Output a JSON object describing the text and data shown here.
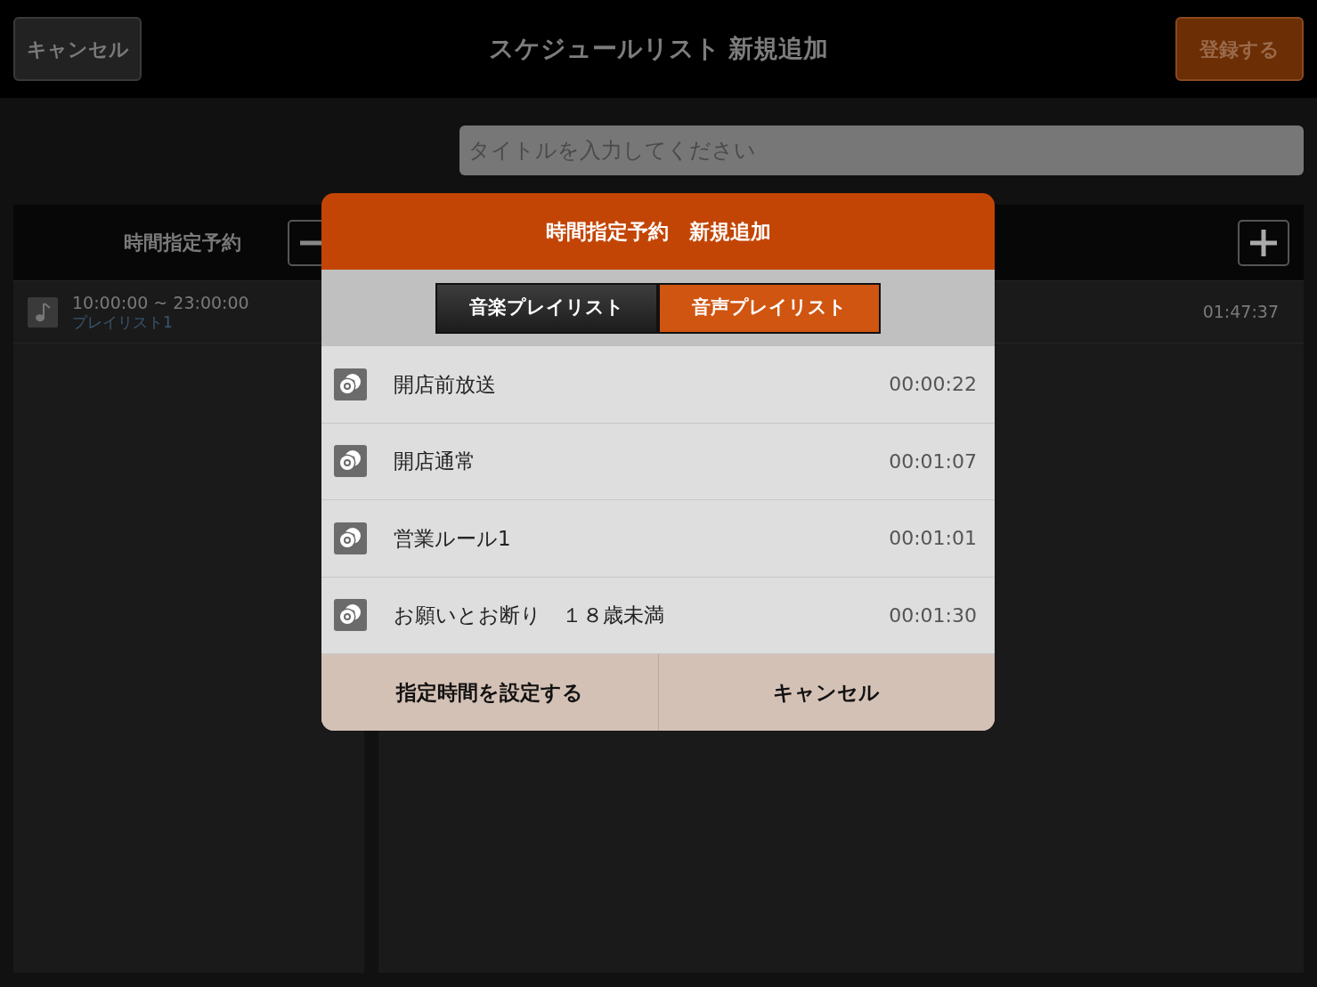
{
  "header": {
    "cancel_button": "キャンセル",
    "title": "スケジュールリスト 新規追加",
    "register_button": "登録する"
  },
  "title_field": {
    "placeholder": "タイトルを入力してください"
  },
  "left_panel": {
    "title": "時間指定予約",
    "items": [
      {
        "time_range": "10:00:00 ~ 23:00:00",
        "playlist": "プレイリスト1"
      }
    ]
  },
  "right_panel": {
    "items": [
      {
        "duration": "01:47:37"
      }
    ]
  },
  "dialog": {
    "title": "時間指定予約　新規追加",
    "tabs": [
      {
        "label": "音楽プレイリスト",
        "selected": false
      },
      {
        "label": "音声プレイリスト",
        "selected": true
      }
    ],
    "items": [
      {
        "name": "開店前放送",
        "duration": "00:00:22"
      },
      {
        "name": "開店通常",
        "duration": "00:01:07"
      },
      {
        "name": "営業ルール1",
        "duration": "00:01:01"
      },
      {
        "name": "お願いとお断り　１８歳未満",
        "duration": "00:01:30"
      }
    ],
    "buttons": [
      "指定時間を設定する",
      "キャンセル"
    ]
  }
}
